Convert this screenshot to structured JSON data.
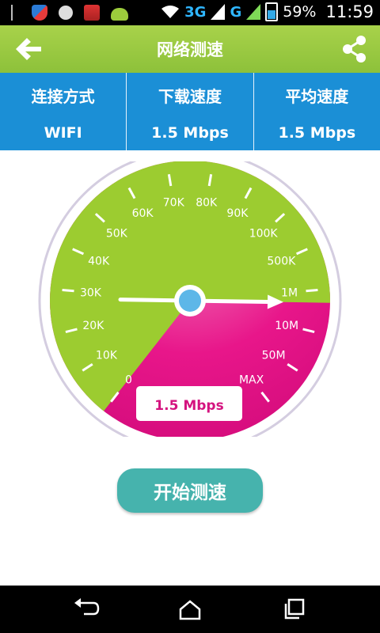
{
  "status_bar": {
    "network_3g": "3G",
    "network_g": "G",
    "sim1": "1",
    "sim2": "2",
    "battery": "59%",
    "time": "11:59"
  },
  "header": {
    "title": "网络测速",
    "back_icon": "arrow-left-icon",
    "share_icon": "share-icon"
  },
  "info": [
    {
      "label": "连接方式",
      "value": "WIFI"
    },
    {
      "label": "下载速度",
      "value": "1.5 Mbps"
    },
    {
      "label": "平均速度",
      "value": "1.5 Mbps"
    }
  ],
  "gauge": {
    "ticks": [
      "0",
      "10K",
      "20K",
      "30K",
      "40K",
      "50K",
      "60K",
      "70K",
      "80K",
      "90K",
      "100K",
      "500K",
      "1M",
      "10M",
      "50M",
      "MAX"
    ],
    "needle_tick_index": 12.3,
    "readout": "1.5 Mbps",
    "colors": {
      "dial": "#e8168a",
      "fill": "#9ccc30",
      "needle": "#ffffff",
      "hub": "#5db7e8"
    }
  },
  "start_button": {
    "label": "开始测速"
  },
  "colors": {
    "header": "#95c73e",
    "infobar": "#1b8fd6",
    "button": "#46b3ad"
  }
}
